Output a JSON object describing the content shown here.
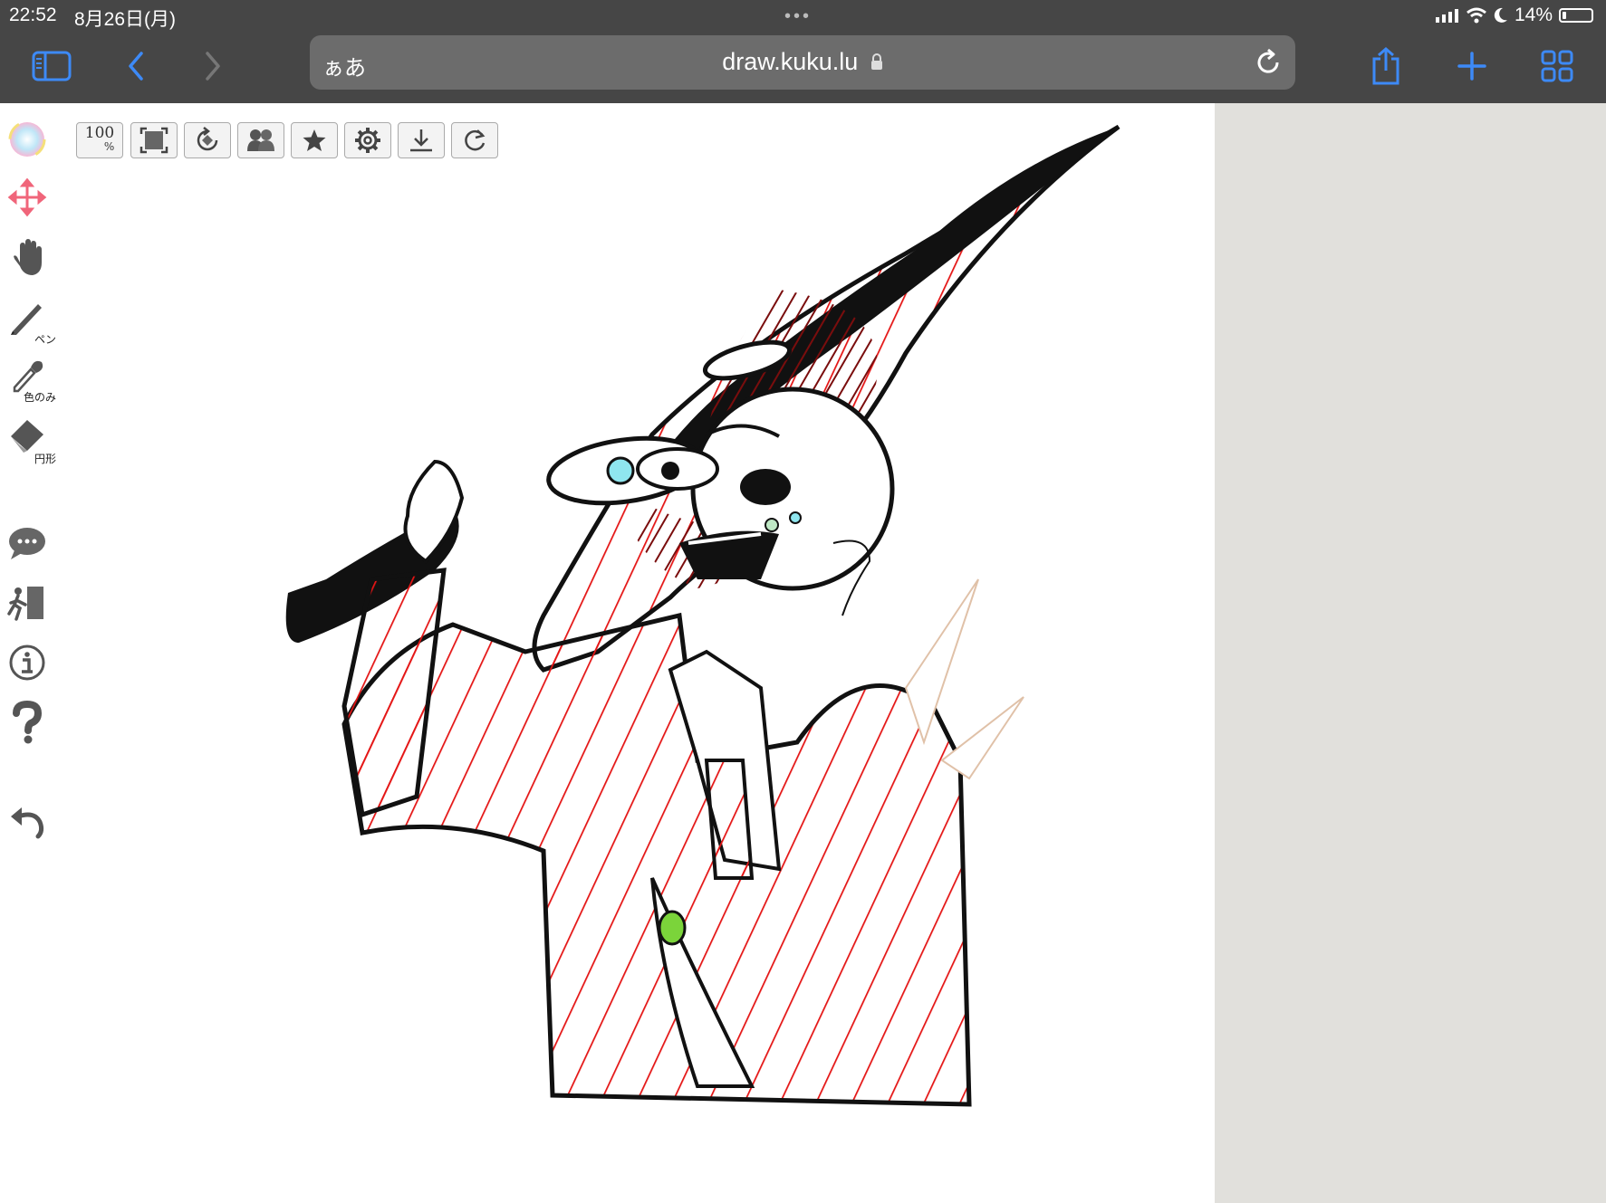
{
  "status_bar": {
    "time": "22:52",
    "date": "8月26日(月)",
    "battery": "14%",
    "battery_fraction": 0.14
  },
  "browser": {
    "text_size_label": "ぁあ",
    "url": "draw.kuku.lu",
    "icons": [
      "sidebar-icon",
      "back-icon",
      "forward-icon",
      "lock-icon",
      "reload-icon",
      "share-icon",
      "new-tab-icon",
      "tabs-overview-icon"
    ]
  },
  "top_tools": {
    "zoom": "100",
    "zoom_unit": "%",
    "icons": [
      "fit-screen-icon",
      "rotate-canvas-icon",
      "layers-icon",
      "favorite-icon",
      "settings-icon",
      "download-icon",
      "redo-icon"
    ]
  },
  "left_tools": {
    "pen_label": "ペン",
    "eyedropper_label": "色のみ",
    "eraser_label": "円形",
    "icons": [
      "color-wheel-icon",
      "move-icon",
      "hand-icon",
      "pen-icon",
      "eyedropper-icon",
      "eraser-icon",
      "chat-icon",
      "exit-icon",
      "info-icon",
      "help-icon",
      "undo-icon"
    ]
  },
  "colors": {
    "chrome_bg": "#464646",
    "urlbar_bg": "#6c6c6c",
    "accent_blue": "#3d8af7",
    "side_panel_bg": "#e1e0dc",
    "ink_red": "#e41414",
    "ink_dark_red": "#7a0d0d"
  }
}
